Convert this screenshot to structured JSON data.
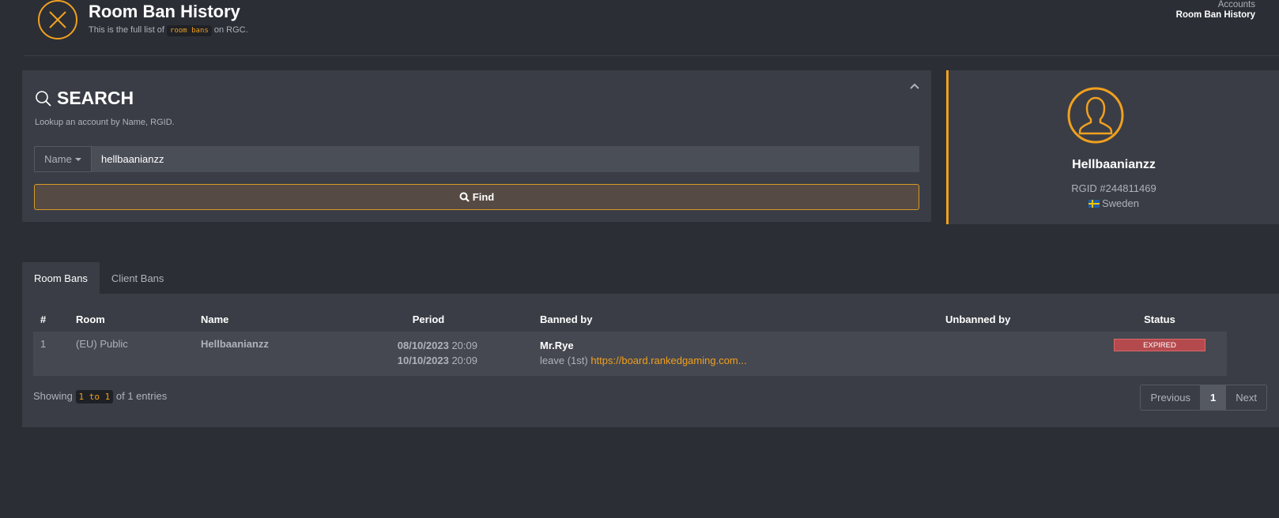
{
  "header": {
    "title": "Room Ban History",
    "subtitle_prefix": "This is the full list of",
    "subtitle_code": "room bans",
    "subtitle_suffix": "on RGC.",
    "icon": "close-circle-icon"
  },
  "breadcrumb": {
    "root": "Accounts",
    "current": "Room Ban History"
  },
  "search": {
    "title": "SEARCH",
    "description": "Lookup an account by Name, RGID.",
    "type_selected": "Name",
    "input_value": "hellbaanianzz",
    "find_label": "Find"
  },
  "profile": {
    "name": "Hellbaanianzz",
    "rgid": "RGID #244811469",
    "country": "Sweden"
  },
  "tabs": [
    {
      "label": "Room Bans",
      "active": true
    },
    {
      "label": "Client Bans",
      "active": false
    }
  ],
  "table": {
    "columns": [
      "#",
      "Room",
      "Name",
      "Period",
      "Banned by",
      "Unbanned by",
      "Status"
    ],
    "rows": [
      {
        "index": "1",
        "room": "(EU) Public",
        "name": "Hellbaanianzz",
        "start_date": "08/10/2023",
        "start_time": "20:09",
        "end_date": "10/10/2023",
        "end_time": "20:09",
        "banned_by": "Mr.Rye",
        "reason": "leave (1st)",
        "reason_link": "https://board.rankedgaming.com...",
        "unbanned_by": "",
        "status": "EXPIRED"
      }
    ]
  },
  "footer": {
    "showing_prefix": "Showing",
    "showing_range": "1 to 1",
    "showing_suffix": "of 1 entries",
    "prev_label": "Previous",
    "page": "1",
    "next_label": "Next"
  },
  "colors": {
    "accent": "#f0a020",
    "background": "#2b2e35",
    "panel": "#3a3d45",
    "status_expired": "#b54a4e"
  }
}
